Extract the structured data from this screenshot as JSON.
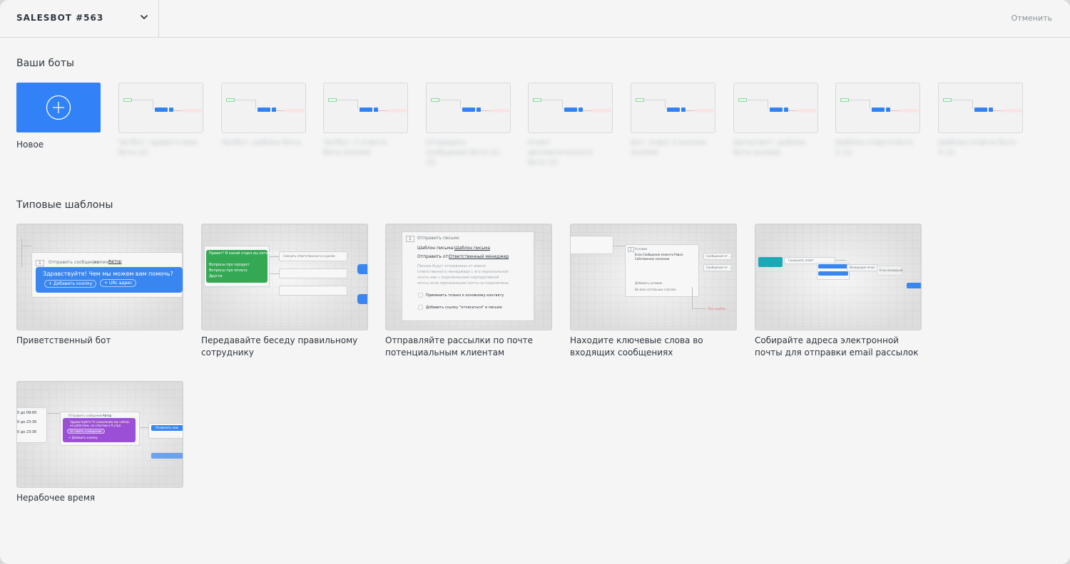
{
  "header": {
    "bot_name": "SALESBOT #563",
    "cancel_label": "Отменить"
  },
  "your_bots": {
    "title": "Ваши боты",
    "new_label": "Новое",
    "bots": [
      {
        "label": "Чатбот: приветствие бота (2)"
      },
      {
        "label": "Чатбот: шаблон бота"
      },
      {
        "label": "Чатбот: 2 ответа бота (копия)"
      },
      {
        "label": "Отправить сообщение бота (1) (2)"
      },
      {
        "label": "Ответ автоматического бота (2)"
      },
      {
        "label": "Бот: ответ 2 кнопки (копия)"
      },
      {
        "label": "Автоответ: шаблон бота (копия)"
      },
      {
        "label": "Шаблон ответа бота 3 (1)"
      },
      {
        "label": "Шаблон ответа бота 4 (1)"
      }
    ]
  },
  "templates": {
    "title": "Типовые шаблоны",
    "items": [
      {
        "label": "Приветственный бот",
        "preview": {
          "step": "1",
          "step_title": "Отправить сообщение",
          "step_sub": "(копия)",
          "author": "Автор",
          "message": "Здравствуйте! Чем мы можем вам помочь?",
          "btn_add": "+ Добавить кнопку",
          "btn_url": "+ URL адрес"
        }
      },
      {
        "label": "Передавайте беседу правильному сотруднику",
        "preview": {
          "question": "Привет! В какой отдел вы хотите обратиться?",
          "option_1": "Вопросы про продукт",
          "option_2": "Вопросы про оплату",
          "option_3": "Другое",
          "handoff": "Сменить ответственного в сделке"
        }
      },
      {
        "label": "Отправляйте рассылки по почте потенциальным клиентам",
        "preview": {
          "step": "1",
          "step_title": "Отправить письмо",
          "template_row": "Шаблон письма:",
          "template_value": "Шаблон письма",
          "sender_row": "Отправить от:",
          "sender_value": "Ответственный менеджер",
          "note": "Письма будут отправлены от имени ответственного менеджера с его персональной почты или с подключенной корпоративной почты если персональная почта не подключена",
          "option_1": "Применить только к основному контакту",
          "option_2": "Добавить ссылку \"отписаться\" в письмо"
        }
      },
      {
        "label": "Находите ключевые слова во входящих сообщениях",
        "preview": {
          "step": "2",
          "condition_1": "Если Сообщение клиента Равно",
          "condition_2": "Собственное значение",
          "step_hint": "Условие",
          "add_condition": "Добавить условие",
          "other_case": "Во всех остальных случаях",
          "result_1": "Сообщение от ...",
          "result_2": "Сообщение от ...",
          "failure_text": "При ошибке"
        }
      },
      {
        "label": "Собирайте адреса электронной почты для отправки email рассылок",
        "preview": {
          "step_1": "Сохранить ответ",
          "step_2": "Валидация email",
          "step_3": "Если валидный"
        }
      }
    ],
    "items_row2": [
      {
        "label": "Нерабочее время",
        "preview": {
          "time_1": "0 до 09:00",
          "time_2": "0 до 23:30",
          "time_3": "0 до 23:30",
          "step_title": "Отправить сообщение",
          "author": "Автор",
          "message": "Здравствуйте! К сожалению мы сейчас не работаем, но ответим в 9 утра",
          "pill": "Оставить сообщение",
          "side_text": "Позвонить нам",
          "add_button": "+ Добавить кнопку"
        }
      }
    ]
  },
  "colors": {
    "accent": "#3182f6",
    "background": "#f5f5f5",
    "text": "#2e3640",
    "muted": "#8a9399"
  }
}
